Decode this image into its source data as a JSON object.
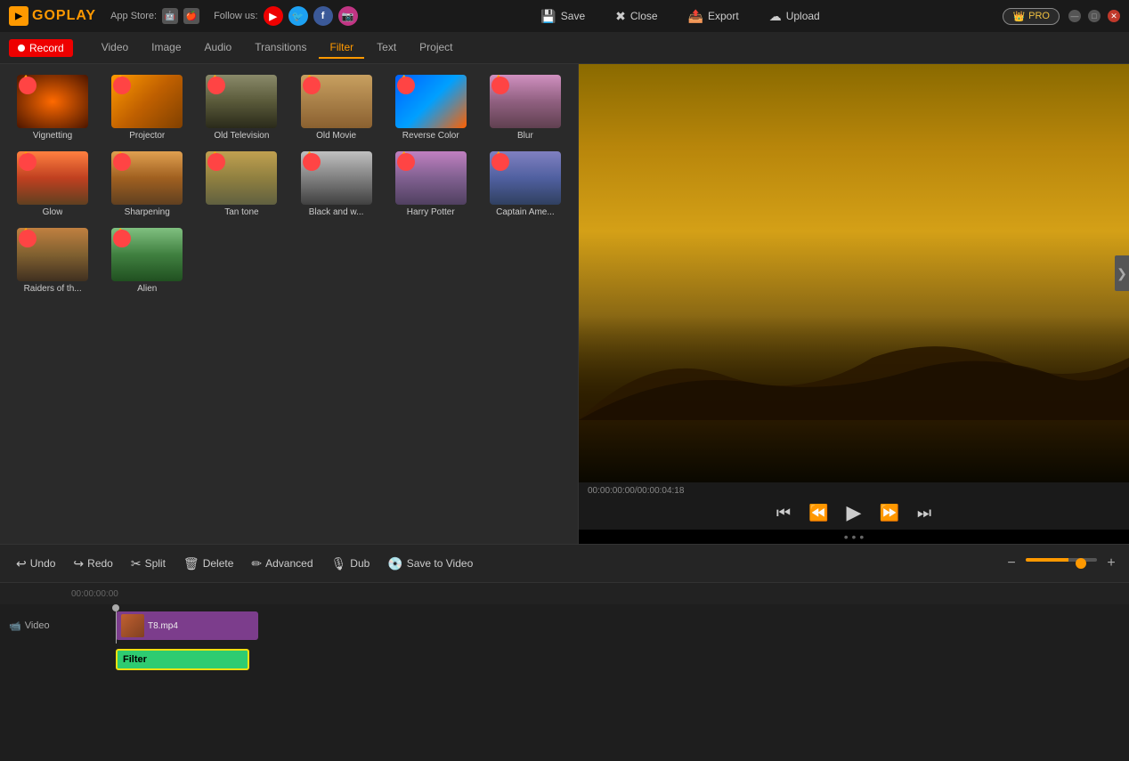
{
  "titlebar": {
    "logo_text": "GOPLAY",
    "appstore_label": "App Store:",
    "follow_label": "Follow us:",
    "pro_label": "PRO",
    "save_label": "Save",
    "close_label": "Close",
    "export_label": "Export",
    "upload_label": "Upload"
  },
  "topnav": {
    "record_label": "Record",
    "tabs": [
      "Video",
      "Image",
      "Audio",
      "Transitions",
      "Filter",
      "Text",
      "Project"
    ]
  },
  "filters": [
    {
      "id": "vignetting",
      "label": "Vignetting",
      "thumb_class": "thumb-vignette"
    },
    {
      "id": "projector",
      "label": "Projector",
      "thumb_class": "thumb-projector"
    },
    {
      "id": "old-television",
      "label": "Old Television",
      "thumb_class": "thumb-oldtv"
    },
    {
      "id": "old-movie",
      "label": "Old Movie",
      "thumb_class": "thumb-oldmovie"
    },
    {
      "id": "reverse-color",
      "label": "Reverse Color",
      "thumb_class": "thumb-reverse"
    },
    {
      "id": "blur",
      "label": "Blur",
      "thumb_class": "thumb-blur"
    },
    {
      "id": "glow",
      "label": "Glow",
      "thumb_class": "thumb-glow"
    },
    {
      "id": "sharpening",
      "label": "Sharpening",
      "thumb_class": "thumb-sharp"
    },
    {
      "id": "tan-tone",
      "label": "Tan tone",
      "thumb_class": "thumb-tan"
    },
    {
      "id": "black-and-white",
      "label": "Black and w...",
      "thumb_class": "thumb-bw"
    },
    {
      "id": "harry-potter",
      "label": "Harry Potter",
      "thumb_class": "thumb-harry"
    },
    {
      "id": "captain-ame",
      "label": "Captain Ame...",
      "thumb_class": "thumb-captain"
    },
    {
      "id": "raiders",
      "label": "Raiders of th...",
      "thumb_class": "thumb-raiders"
    },
    {
      "id": "alien",
      "label": "Alien",
      "thumb_class": "thumb-alien"
    }
  ],
  "preview": {
    "time_display": "00:00:00:00/00:00:04:18"
  },
  "toolbar": {
    "undo_label": "Undo",
    "redo_label": "Redo",
    "split_label": "Split",
    "delete_label": "Delete",
    "advanced_label": "Advanced",
    "dub_label": "Dub",
    "save_to_video_label": "Save to Video"
  },
  "timeline": {
    "time_marker": "00:00:00:00",
    "video_track_label": "Video",
    "clip_label": "T8.mp4",
    "filter_label": "Filter"
  }
}
